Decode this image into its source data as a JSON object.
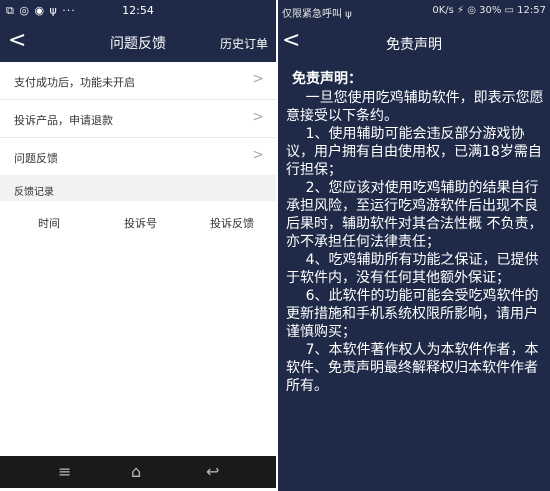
{
  "left": {
    "status": {
      "left_icons": "⧉ ◎ ◉ ψ ···",
      "time": "12:54",
      "right_icons": "✈"
    },
    "nav": {
      "back": "<",
      "title": "问题反馈",
      "history": "历史订单"
    },
    "menu": [
      {
        "label": "支付成功后，功能未开启",
        "chevron": ">"
      },
      {
        "label": "投诉产品，申请退款",
        "chevron": ">"
      },
      {
        "label": "问题反馈",
        "chevron": ">"
      }
    ],
    "section_label": "反馈记录",
    "table_headers": [
      "时间",
      "投诉号",
      "投诉反馈"
    ],
    "bottom": {
      "menu": "≡",
      "home": "⌂",
      "back": "↩"
    }
  },
  "right": {
    "status": {
      "left": "仅限紧急呼叫 ψ",
      "right": "0K/s ⚡ ◎ 30% ▭ 12:57"
    },
    "nav": {
      "back": "<",
      "title": "免责声明"
    },
    "heading": "免责声明：",
    "paragraphs": [
      "一旦您使用吃鸡辅助软件，即表示您愿意接受以下条约。",
      "1、使用辅助可能会违反部分游戏协议，用户拥有自由使用权，已满18岁需自行担保；",
      "2、您应该对使用吃鸡辅助的结果自行承担风险，至运行吃鸡游软件后出现不良后果时，辅助软件对其合法性概 不负责，亦不承担任何法律责任；",
      "4、吃鸡辅助所有功能之保证，已提供于软件内，没有任何其他额外保证；",
      "6、此软件的功能可能会受吃鸡软件的更新措施和手机系统权限所影响，请用户谨慎购买；",
      "7、本软件著作权人为本软件作者，本软件、免责声明最终解释权归本软件作者所有。"
    ]
  },
  "colors": {
    "nav_bg": "#1e2a47",
    "section_bg": "#f2f2f2",
    "bottom_bar": "#1a1a1a"
  }
}
